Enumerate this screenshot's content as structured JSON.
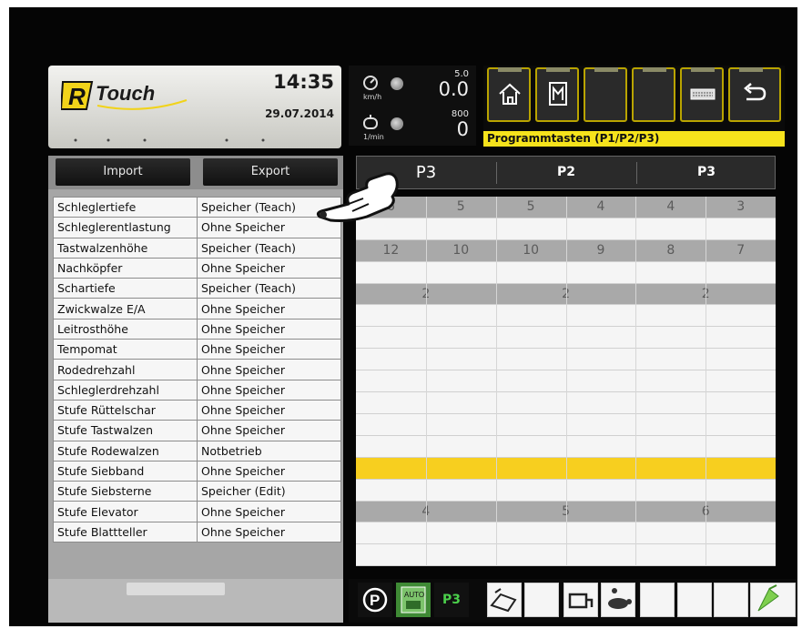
{
  "header": {
    "logo_text": "Touch",
    "time": "14:35",
    "date": "29.07.2014"
  },
  "gauges": {
    "speed": {
      "unit": "km/h",
      "small": "5.0",
      "value": "0.0"
    },
    "rpm": {
      "unit": "1/min",
      "small": "800",
      "value": "0"
    }
  },
  "toolbar": {
    "buttons": [
      "home-icon",
      "memory-card-icon",
      "empty",
      "empty",
      "keyboard-icon",
      "back-icon"
    ],
    "banner": "Programmtasten (P1/P2/P3)"
  },
  "actions": {
    "import_label": "Import",
    "export_label": "Export"
  },
  "programs": {
    "selected": "P3",
    "col2": "P2",
    "col3": "P3"
  },
  "rows": [
    {
      "name": "Schleglertiefe",
      "mode": "Speicher (Teach)",
      "style": "dark",
      "values": [
        "6",
        "5",
        "5",
        "4",
        "4",
        "3"
      ]
    },
    {
      "name": "Schleglerentlastung",
      "mode": "Ohne Speicher",
      "style": "plain",
      "values": []
    },
    {
      "name": "Tastwalzenhöhe",
      "mode": "Speicher (Teach)",
      "style": "dark",
      "values": [
        "12",
        "10",
        "10",
        "9",
        "8",
        "7"
      ]
    },
    {
      "name": "Nachköpfer",
      "mode": "Ohne Speicher",
      "style": "plain",
      "values": []
    },
    {
      "name": "Schartiefe",
      "mode": "Speicher (Teach)",
      "style": "dark",
      "values": [
        "2",
        "2",
        "2"
      ]
    },
    {
      "name": "Zwickwalze E/A",
      "mode": "Ohne Speicher",
      "style": "plain",
      "values": []
    },
    {
      "name": "Leitrosthöhe",
      "mode": "Ohne Speicher",
      "style": "plain",
      "values": []
    },
    {
      "name": "Tempomat",
      "mode": "Ohne Speicher",
      "style": "plain",
      "values": []
    },
    {
      "name": "Rodedrehzahl",
      "mode": "Ohne Speicher",
      "style": "plain",
      "values": []
    },
    {
      "name": "Schleglerdrehzahl",
      "mode": "Ohne Speicher",
      "style": "plain",
      "values": []
    },
    {
      "name": "Stufe Rüttelschar",
      "mode": "Ohne Speicher",
      "style": "plain",
      "values": []
    },
    {
      "name": "Stufe Tastwalzen",
      "mode": "Ohne Speicher",
      "style": "plain",
      "values": []
    },
    {
      "name": "Stufe Rodewalzen",
      "mode": "Notbetrieb",
      "style": "yellow",
      "values": []
    },
    {
      "name": "Stufe Siebband",
      "mode": "Ohne Speicher",
      "style": "plain",
      "values": []
    },
    {
      "name": "Stufe Siebsterne",
      "mode": "Speicher (Edit)",
      "style": "dark",
      "values": [
        "4",
        "5",
        "6"
      ]
    },
    {
      "name": "Stufe Elevator",
      "mode": "Ohne Speicher",
      "style": "plain",
      "values": []
    },
    {
      "name": "Stufe Blattteller",
      "mode": "Ohne Speicher",
      "style": "plain",
      "values": []
    }
  ],
  "statusbar": {
    "items": [
      "parking-icon",
      "auto-mode-icon",
      "P3",
      "shaker-icon",
      "empty",
      "machine-icon",
      "turtle-icon",
      "empty",
      "empty",
      "empty",
      "satellite-icon"
    ]
  },
  "colors": {
    "banner": "#f6e31c",
    "highlight_row": "#f7cf1f",
    "teach_row": "#a9a9a9"
  }
}
